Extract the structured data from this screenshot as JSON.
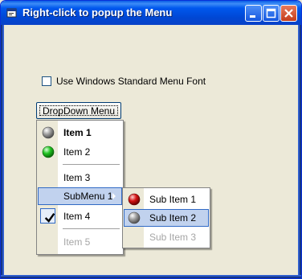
{
  "window": {
    "title": "Right-click to popup the Menu"
  },
  "checkbox": {
    "label": "Use Windows Standard Menu Font",
    "checked": false
  },
  "dropdown_button": {
    "label": "DropDown Menu"
  },
  "menu": {
    "items": [
      {
        "label": "Item 1",
        "icon": "gray-sphere-icon",
        "bold": true
      },
      {
        "label": "Item 2",
        "icon": "green-sphere-icon"
      },
      {
        "label": "Item 3"
      },
      {
        "label": "SubMenu 1",
        "has_submenu": true,
        "highlighted": true
      },
      {
        "label": "Item 4",
        "icon": "checkmark-icon",
        "checked": true
      },
      {
        "label": "Item 5",
        "disabled": true
      }
    ]
  },
  "submenu": {
    "items": [
      {
        "label": "Sub Item 1",
        "icon": "red-sphere-icon"
      },
      {
        "label": "Sub Item 2",
        "icon": "gray-sphere-icon",
        "highlighted": true
      },
      {
        "label": "Sub Item 3",
        "disabled": true
      }
    ]
  },
  "colors": {
    "titlebar": "#0054e3",
    "highlight_bg": "#c1d2ee",
    "highlight_border": "#316ac5",
    "face": "#ece9d8",
    "disabled_text": "#a6a6a6"
  }
}
